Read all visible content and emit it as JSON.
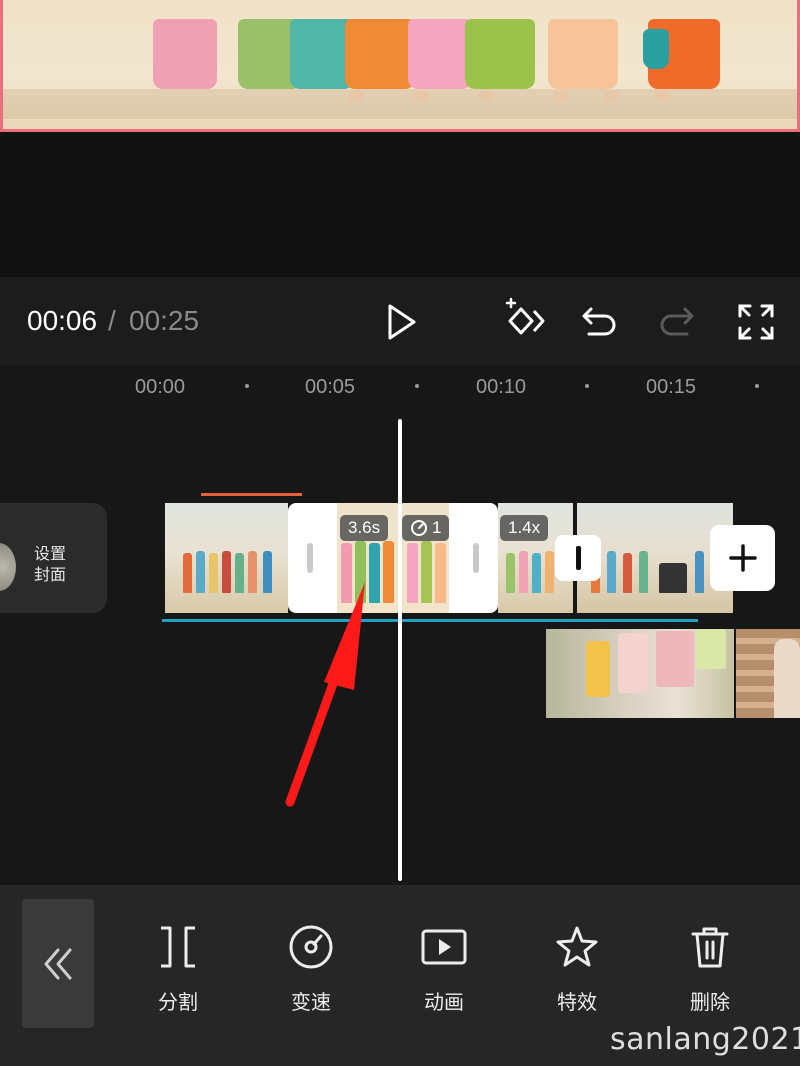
{
  "player": {
    "current_time": "00:06",
    "separator": "/",
    "total_time": "00:25"
  },
  "ruler": {
    "ticks": [
      "00:00",
      "00:05",
      "00:10",
      "00:15"
    ]
  },
  "cover": {
    "line1": "设置",
    "line2": "封面"
  },
  "selected_clip": {
    "duration": "3.6s",
    "speed_badge": "1"
  },
  "next_clip": {
    "speed": "1.4x"
  },
  "toolbar": {
    "items": [
      {
        "label": "分割",
        "icon": "split-icon"
      },
      {
        "label": "变速",
        "icon": "speed-icon"
      },
      {
        "label": "动画",
        "icon": "animation-icon"
      },
      {
        "label": "特效",
        "icon": "effects-icon"
      },
      {
        "label": "删除",
        "icon": "delete-icon"
      }
    ]
  },
  "watermark": "sanlang2021",
  "colors": {
    "accent_border": "#e8707c",
    "orange_track": "#e5623a",
    "blue_track": "#1ba3c4",
    "arrow": "#ff1a1a"
  }
}
